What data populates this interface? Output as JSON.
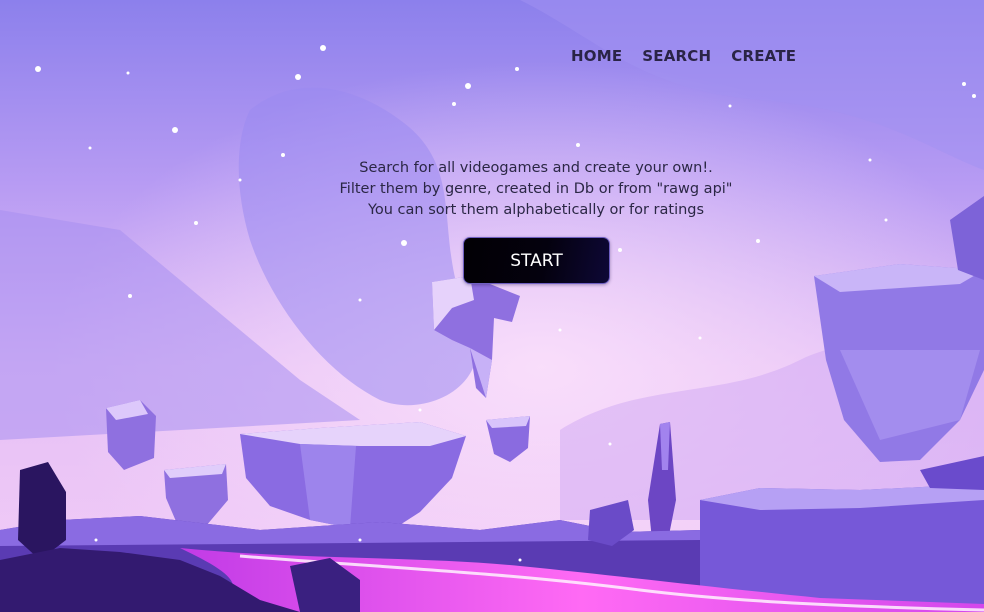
{
  "nav": {
    "home_label": "HOME",
    "search_label": "SEARCH",
    "create_label": "CREATE"
  },
  "intro": {
    "line1": "Search for all videogames and create your own!.",
    "line2": "Filter them by genre, created in Db or from \"rawg api\"",
    "line3": "You can sort them alphabetically or for ratings"
  },
  "start_button": {
    "label": "START"
  },
  "colors": {
    "sky_top": "#8f82ee",
    "sky_mid": "#d9b6f5",
    "rock": "#7b5fd6",
    "lava": "#ff58f0",
    "nav_text": "#2a2446",
    "button_bg": "#03010a"
  }
}
